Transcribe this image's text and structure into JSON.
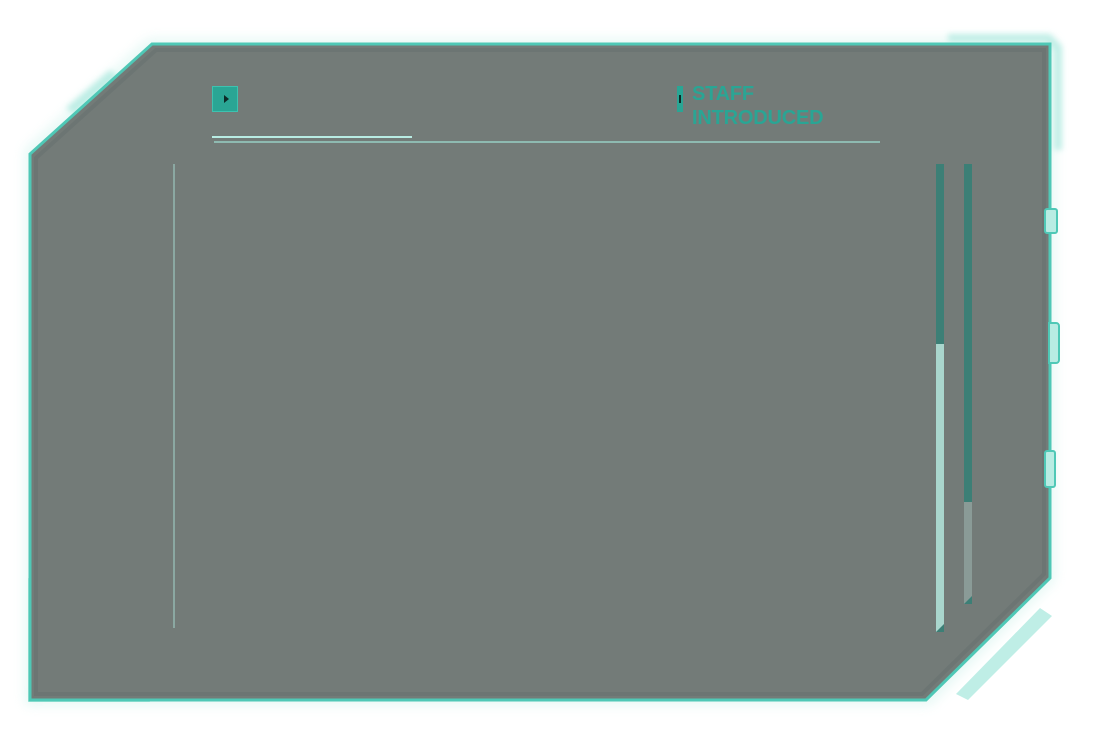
{
  "panel": {
    "title": "STAFF\nINTRODUCED",
    "content_text": ""
  },
  "controls": {
    "play_icon": "play-icon",
    "scrollbar_primary_position": 0.38,
    "scrollbar_secondary_position": 0.76
  },
  "colors": {
    "panel_background": "#737b78",
    "frame_accent": "#4fc8b6",
    "frame_light": "#b8ece3",
    "title_color": "#2aa594"
  }
}
